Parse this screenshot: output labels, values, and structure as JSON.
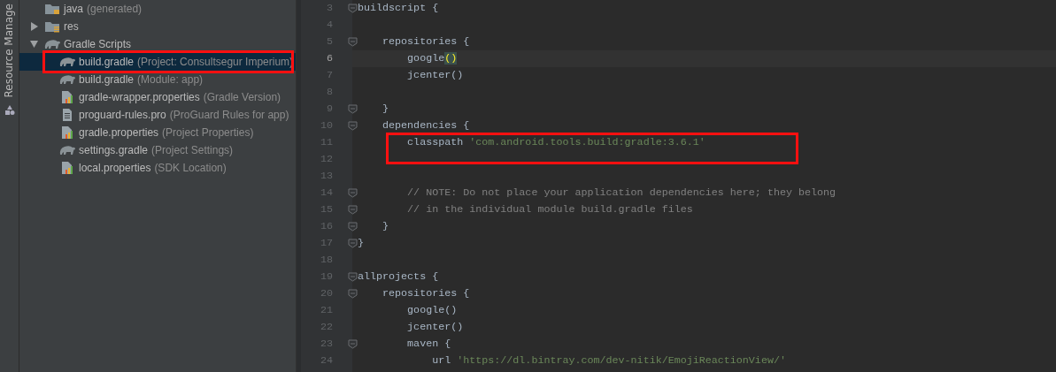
{
  "tool_strip": {
    "label": "Resource Manage"
  },
  "project_tree": {
    "items": [
      {
        "kind": "folder-generated",
        "name": "java",
        "hint": "(generated)",
        "selected": false,
        "highlighted": false
      },
      {
        "kind": "folder-res",
        "name": "res",
        "expanded": false,
        "selected": false,
        "highlighted": false
      },
      {
        "kind": "gradle",
        "name": "Gradle Scripts",
        "expanded": true,
        "selected": false,
        "highlighted": false,
        "children": [
          {
            "kind": "gradle",
            "name": "build.gradle",
            "hint": "(Project: Consultsegur Imperium)",
            "selected": true,
            "highlighted": true
          },
          {
            "kind": "gradle",
            "name": "build.gradle",
            "hint": "(Module: app)",
            "selected": false,
            "highlighted": false
          },
          {
            "kind": "properties",
            "name": "gradle-wrapper.properties",
            "hint": "(Gradle Version)",
            "selected": false,
            "highlighted": false
          },
          {
            "kind": "file",
            "name": "proguard-rules.pro",
            "hint": "(ProGuard Rules for app)",
            "selected": false,
            "highlighted": false
          },
          {
            "kind": "properties",
            "name": "gradle.properties",
            "hint": "(Project Properties)",
            "selected": false,
            "highlighted": false
          },
          {
            "kind": "gradle",
            "name": "settings.gradle",
            "hint": "(Project Settings)",
            "selected": false,
            "highlighted": false
          },
          {
            "kind": "properties",
            "name": "local.properties",
            "hint": "(SDK Location)",
            "selected": false,
            "highlighted": false
          }
        ]
      }
    ]
  },
  "editor": {
    "lines": [
      {
        "number": "3",
        "fold": true,
        "current": false,
        "highlighted": false,
        "tokens": [
          {
            "kind": "plain",
            "text": "buildscript {"
          }
        ]
      },
      {
        "number": "4",
        "fold": false,
        "current": false,
        "highlighted": false
      },
      {
        "number": "5",
        "fold": true,
        "current": false,
        "highlighted": false,
        "tokens": [
          {
            "kind": "plain",
            "text": "    repositories {"
          }
        ]
      },
      {
        "number": "6",
        "fold": false,
        "current": true,
        "highlighted": false,
        "tokens": [
          {
            "kind": "plain",
            "text": "        google"
          },
          {
            "kind": "match",
            "text": "()"
          }
        ]
      },
      {
        "number": "7",
        "fold": false,
        "current": false,
        "highlighted": false,
        "tokens": [
          {
            "kind": "plain",
            "text": "        jcenter()"
          }
        ]
      },
      {
        "number": "8",
        "fold": false,
        "current": false,
        "highlighted": false
      },
      {
        "number": "9",
        "fold": true,
        "current": false,
        "highlighted": false,
        "tokens": [
          {
            "kind": "plain",
            "text": "    }"
          }
        ]
      },
      {
        "number": "10",
        "fold": true,
        "current": false,
        "highlighted": false,
        "tokens": [
          {
            "kind": "plain",
            "text": "    dependencies {"
          }
        ]
      },
      {
        "number": "11",
        "fold": false,
        "current": false,
        "highlighted": true,
        "tokens": [
          {
            "kind": "plain",
            "text": "        classpath "
          },
          {
            "kind": "string",
            "text": "'com.android.tools.build:gradle:3.6.1'"
          }
        ]
      },
      {
        "number": "12",
        "fold": false,
        "current": false,
        "highlighted": false
      },
      {
        "number": "13",
        "fold": false,
        "current": false,
        "highlighted": false
      },
      {
        "number": "14",
        "fold": true,
        "current": false,
        "highlighted": false,
        "tokens": [
          {
            "kind": "comment",
            "text": "        // NOTE: Do not place your application dependencies here; they belong"
          }
        ]
      },
      {
        "number": "15",
        "fold": true,
        "current": false,
        "highlighted": false,
        "tokens": [
          {
            "kind": "comment",
            "text": "        // in the individual module build.gradle files"
          }
        ]
      },
      {
        "number": "16",
        "fold": true,
        "current": false,
        "highlighted": false,
        "tokens": [
          {
            "kind": "plain",
            "text": "    }"
          }
        ]
      },
      {
        "number": "17",
        "fold": true,
        "current": false,
        "highlighted": false,
        "tokens": [
          {
            "kind": "plain",
            "text": "}"
          }
        ]
      },
      {
        "number": "18",
        "fold": false,
        "current": false,
        "highlighted": false
      },
      {
        "number": "19",
        "fold": true,
        "current": false,
        "highlighted": false,
        "tokens": [
          {
            "kind": "plain",
            "text": "allprojects {"
          }
        ]
      },
      {
        "number": "20",
        "fold": true,
        "current": false,
        "highlighted": false,
        "tokens": [
          {
            "kind": "plain",
            "text": "    repositories {"
          }
        ]
      },
      {
        "number": "21",
        "fold": false,
        "current": false,
        "highlighted": false,
        "tokens": [
          {
            "kind": "plain",
            "text": "        google()"
          }
        ]
      },
      {
        "number": "22",
        "fold": false,
        "current": false,
        "highlighted": false,
        "tokens": [
          {
            "kind": "plain",
            "text": "        jcenter()"
          }
        ]
      },
      {
        "number": "23",
        "fold": true,
        "current": false,
        "highlighted": false,
        "tokens": [
          {
            "kind": "plain",
            "text": "        maven {"
          }
        ]
      },
      {
        "number": "24",
        "fold": false,
        "current": false,
        "highlighted": false,
        "tokens": [
          {
            "kind": "plain",
            "text": "            url "
          },
          {
            "kind": "string",
            "text": "'https://dl.bintray.com/dev-nitik/EmojiReactionView/'"
          }
        ]
      }
    ]
  }
}
